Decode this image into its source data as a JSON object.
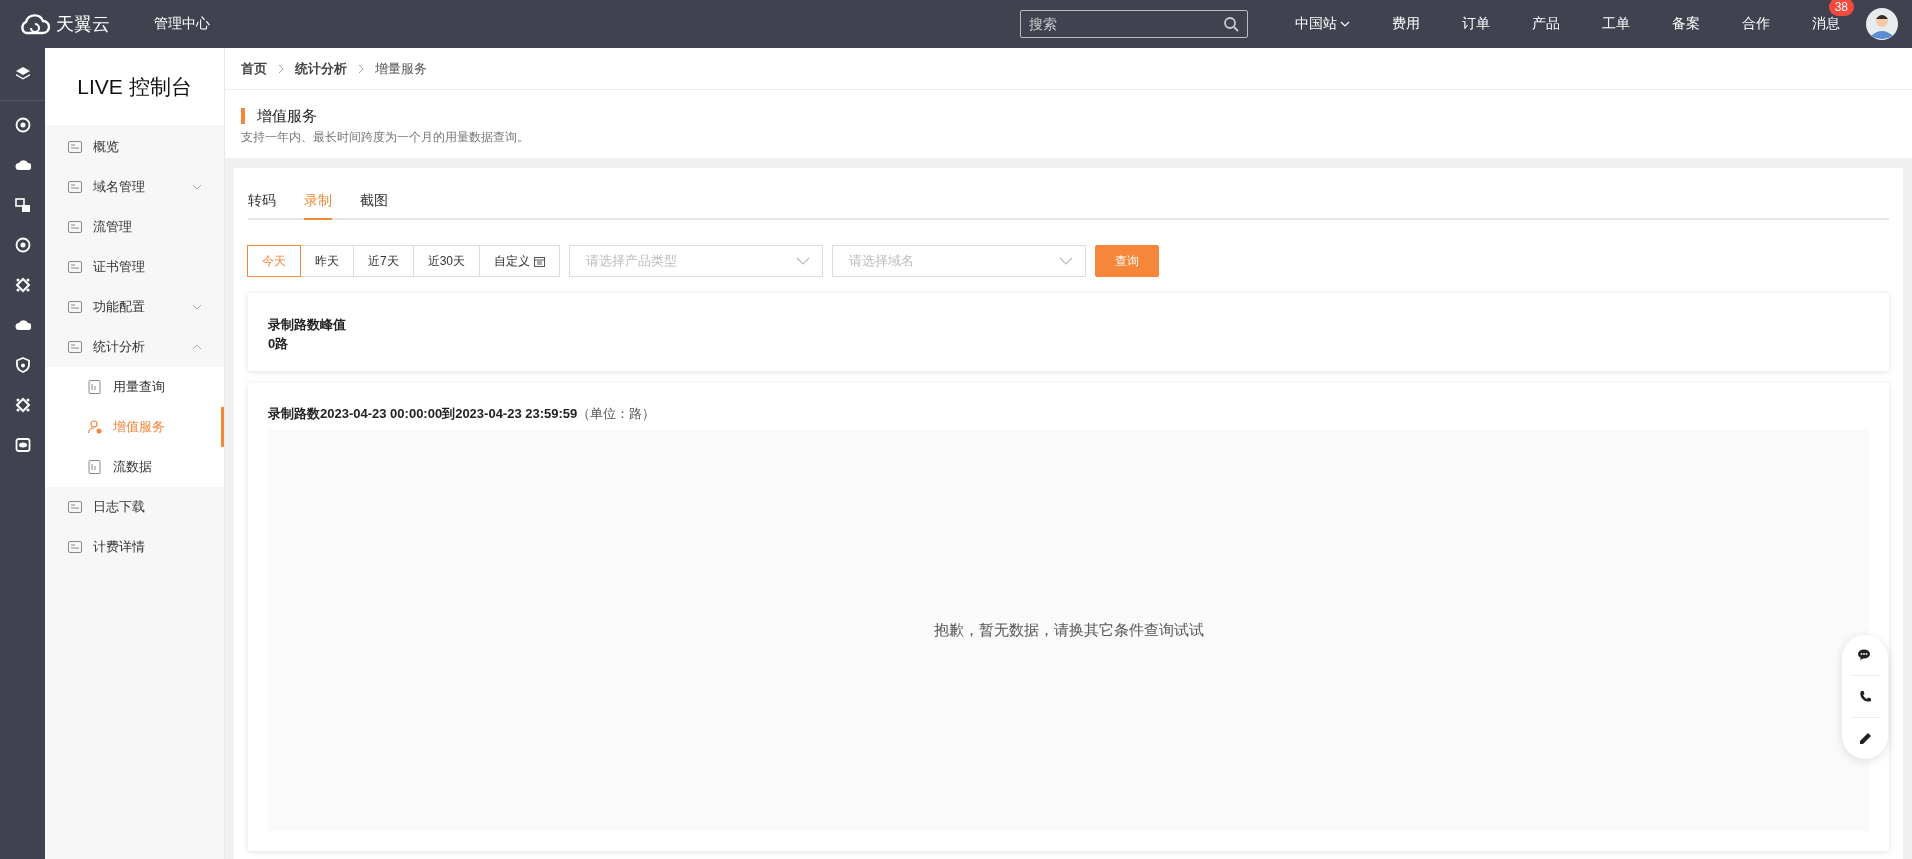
{
  "topbar": {
    "logo": "天翼云",
    "console": "管理中心",
    "search": {
      "placeholder": "搜索"
    },
    "nav": [
      {
        "label": "中国站",
        "dropdown": true
      },
      {
        "label": "费用",
        "dropdown": false
      },
      {
        "label": "订单",
        "dropdown": false
      },
      {
        "label": "产品",
        "dropdown": false
      },
      {
        "label": "工单",
        "dropdown": false
      },
      {
        "label": "备案",
        "dropdown": false
      },
      {
        "label": "合作",
        "dropdown": false
      }
    ],
    "messages": {
      "label": "消息",
      "badge": "38"
    }
  },
  "sidebar": {
    "title": "LIVE 控制台",
    "items": [
      {
        "label": "概览",
        "selected": false
      },
      {
        "label": "域名管理",
        "selected": false,
        "expanded": false
      },
      {
        "label": "流管理",
        "selected": false
      },
      {
        "label": "证书管理",
        "selected": false
      },
      {
        "label": "功能配置",
        "selected": false,
        "expanded": false
      },
      {
        "label": "统计分析",
        "selected": false,
        "expanded": true,
        "children": [
          {
            "label": "用量查询",
            "selected": false
          },
          {
            "label": "增值服务",
            "selected": true
          },
          {
            "label": "流数据",
            "selected": false
          }
        ]
      },
      {
        "label": "日志下载",
        "selected": false
      },
      {
        "label": "计费详情",
        "selected": false
      }
    ]
  },
  "breadcrumb": [
    "首页",
    "统计分析",
    "增量服务"
  ],
  "header": {
    "title": "增值服务",
    "description": "支持一年内、最长时间跨度为一个月的用量数据查询。"
  },
  "tabs": [
    {
      "label": "转码",
      "selected": false
    },
    {
      "label": "录制",
      "selected": true
    },
    {
      "label": "截图",
      "selected": false
    }
  ],
  "ranges": [
    {
      "label": "今天",
      "kind": "preset",
      "selected": true
    },
    {
      "label": "昨天",
      "kind": "preset",
      "selected": false
    },
    {
      "label": "近7天",
      "kind": "preset",
      "selected": false
    },
    {
      "label": "近30天",
      "kind": "preset",
      "selected": false
    },
    {
      "label": "自定义",
      "kind": "custom",
      "selected": false
    }
  ],
  "selects": [
    {
      "placeholder": "请选择产品类型"
    },
    {
      "placeholder": "请选择域名"
    }
  ],
  "query_button": "查询",
  "peak": {
    "label": "录制路数峰值",
    "value": "0路"
  },
  "chart": {
    "title": "录制路数2023-04-23 00:00:00到2023-04-23 23:59:59",
    "unit": "（单位：路）",
    "empty": "抱歉，暂无数据，请换其它条件查询试试"
  }
}
